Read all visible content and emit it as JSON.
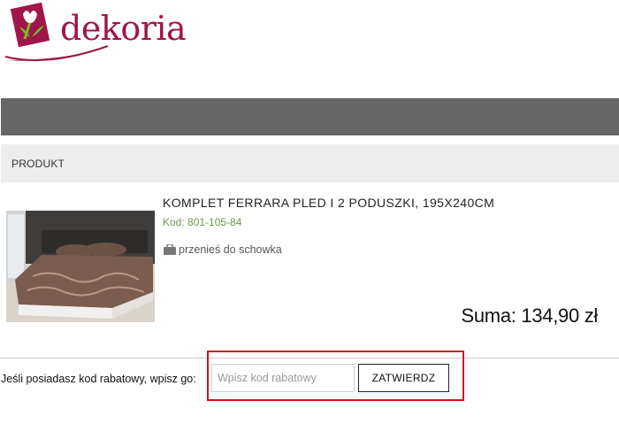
{
  "brand": {
    "name": "dekoria",
    "color": "#a0154a"
  },
  "table": {
    "header_product": "PRODUKT"
  },
  "product": {
    "name": "KOMPLET FERRARA PLED I 2 PODUSZKI, 195X240CM",
    "code": "Kod: 801-105-84",
    "wishlist_label": "przenieś do schowka",
    "wishlist_icon": "briefcase-icon",
    "image_alt": "bedspread-with-pillows"
  },
  "summary": {
    "total": "Suma: 134,90 zł"
  },
  "coupon": {
    "label": "Jeśli posiadasz kod rabatowy, wpisz go:",
    "placeholder": "Wpisz kod rabatowy",
    "value": "",
    "button_label": "ZATWIERDZ",
    "highlight_color": "#d0121b"
  }
}
